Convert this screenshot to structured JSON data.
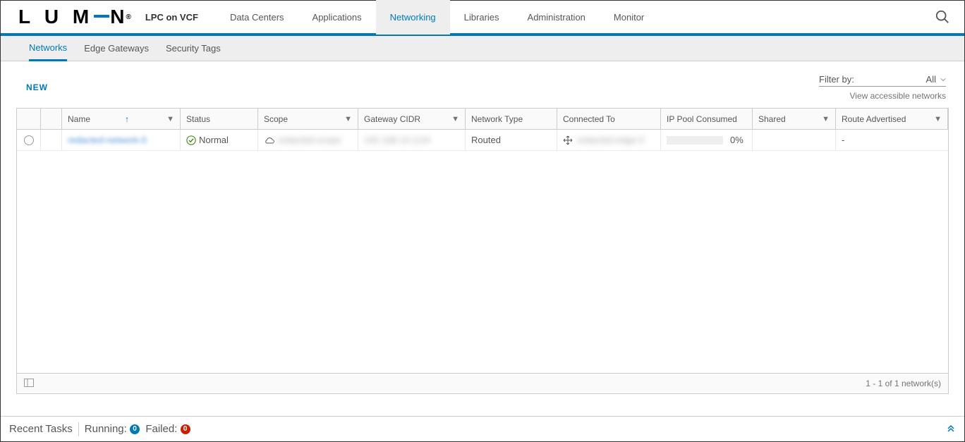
{
  "header": {
    "product_name": "LPC on VCF",
    "nav": {
      "data_centers": "Data Centers",
      "applications": "Applications",
      "networking": "Networking",
      "libraries": "Libraries",
      "administration": "Administration",
      "monitor": "Monitor"
    }
  },
  "subnav": {
    "networks": "Networks",
    "edge_gateways": "Edge Gateways",
    "security_tags": "Security Tags"
  },
  "toolbar": {
    "new_label": "NEW",
    "filter_by_label": "Filter by:",
    "filter_value": "All",
    "accessible_link": "View accessible networks"
  },
  "columns": {
    "name": "Name",
    "status": "Status",
    "scope": "Scope",
    "gateway_cidr": "Gateway CIDR",
    "network_type": "Network Type",
    "connected_to": "Connected To",
    "ip_pool": "IP Pool Consumed",
    "shared": "Shared",
    "route_adv": "Route Advertised"
  },
  "rows": [
    {
      "name": "redacted-network-0",
      "status": "Normal",
      "scope": "redacted-scope",
      "gateway_cidr": "192.168.10.1/24",
      "network_type": "Routed",
      "connected_to": "redacted-edge-0",
      "ip_pool_pct": "0%",
      "shared": "",
      "route_adv": "-"
    }
  ],
  "footer": {
    "pagination": "1 - 1 of 1 network(s)"
  },
  "statusbar": {
    "recent_tasks": "Recent Tasks",
    "running_label": "Running:",
    "running_count": "0",
    "failed_label": "Failed:",
    "failed_count": "0"
  }
}
